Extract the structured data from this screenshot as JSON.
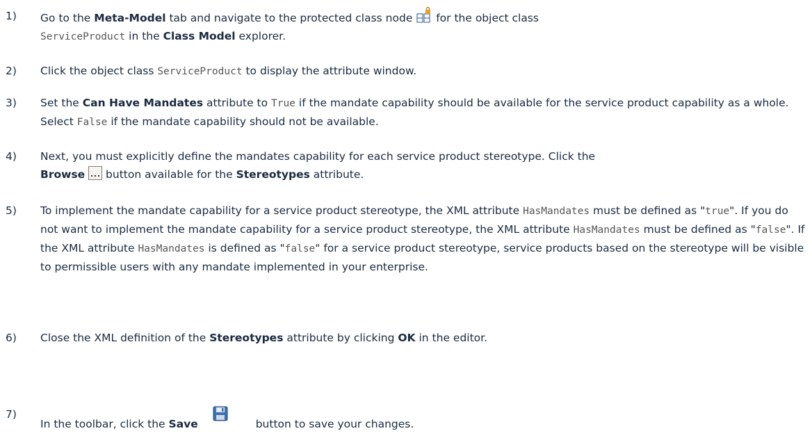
{
  "steps": [
    {
      "num": "1)",
      "t1": "Go to the ",
      "b1": "Meta-Model",
      "t2": " tab and navigate to the protected class node ",
      "icon": "protected-class-node-icon",
      "t3": " for the object class",
      "c1": "ServiceProduct",
      "t4": " in the ",
      "b2": "Class Model",
      "t5": " explorer."
    },
    {
      "num": "2)",
      "t1": "Click the object class ",
      "c1": "ServiceProduct",
      "t2": " to display the attribute window."
    },
    {
      "num": "3)",
      "t1": "Set the ",
      "b1": "Can Have Mandates",
      "t2": " attribute to ",
      "c1": "True",
      "t3": " if the mandate capability should be available for the service product capability as a whole. Select ",
      "c2": "False",
      "t4": " if the mandate capability should not be available."
    },
    {
      "num": "4)",
      "t1": "Next, you must explicitly define the mandates capability for each service product stereotype. Click the",
      "b1": "Browse",
      "icon": "browse-ellipsis-icon",
      "t2": " button available for the ",
      "b2": "Stereotypes",
      "t3": " attribute."
    },
    {
      "num": "5)",
      "t1": "To implement the mandate capability for a service product stereotype, the XML attribute ",
      "c1": "HasMandates",
      "t2": " must be defined as \"",
      "c2": "true",
      "t3": "\". If you do not want to implement the mandate capability for a service product stereotype, the XML attribute ",
      "c3": "HasMandates",
      "t4": " must be defined as \"",
      "c4": "false",
      "t5": "\". If the XML attribute ",
      "c5": "HasMandates",
      "t6": " is defined as \"",
      "c6": "false",
      "t7": "\" for a service product stereotype, service products based on the stereotype will be visible to permissible users with any mandate implemented in your enterprise."
    },
    {
      "num": "6)",
      "t1": "Close the XML definition of the ",
      "b1": "Stereotypes",
      "t2": " attribute by clicking ",
      "b2": "OK",
      "t3": " in the editor."
    },
    {
      "num": "7)",
      "t1": "In the toolbar, click the ",
      "b1": "Save",
      "icon": "save-floppy-icon",
      "t2": " button to save your changes."
    }
  ],
  "colors": {
    "text": "#1a2a40",
    "code": "#555555",
    "icon_blue": "#4a6fa5",
    "icon_orange": "#e8a020"
  }
}
